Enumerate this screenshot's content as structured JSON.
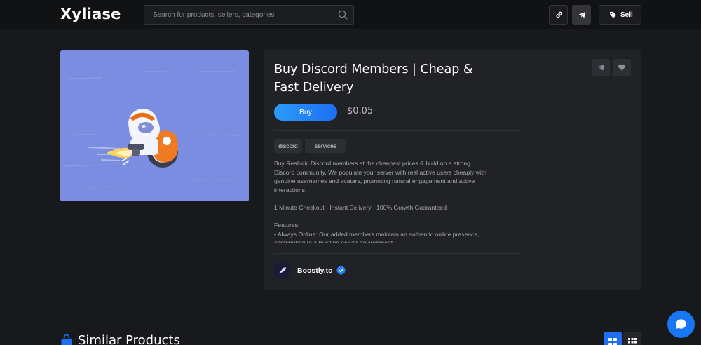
{
  "header": {
    "logo": "Xyliase",
    "search_placeholder": "Search for products, sellers, categories",
    "sell_label": "Sell",
    "icons": {
      "search": "search-icon",
      "link": "link-icon",
      "telegram": "telegram-icon",
      "tag": "tag-icon"
    }
  },
  "product": {
    "title": "Buy Discord Members | Cheap & Fast Delivery",
    "buy_label": "Buy",
    "price": "$0.05",
    "tags": [
      "discord",
      "services"
    ],
    "description": [
      "Buy Realistic Discord members at the cheapest prices & build up a strong Discord community. We populate your server with real active users cheaply with genuine usernames and avatars, promoting natural engagement and active interactions.",
      "1 Minute Checkout - Instant Delivery - 100% Growth Guaranteed",
      "Features:\n• Always Online: Our added members maintain an authentic online presence, contributing to a bustling server environment."
    ],
    "seller": {
      "name": "Boostly.to",
      "verified": true
    }
  },
  "similar": {
    "title": "Similar Products"
  },
  "colors": {
    "accent": "#1e6ff2",
    "background": "#18191d",
    "panel": "#212226",
    "image_bg": "#7b8de0"
  }
}
